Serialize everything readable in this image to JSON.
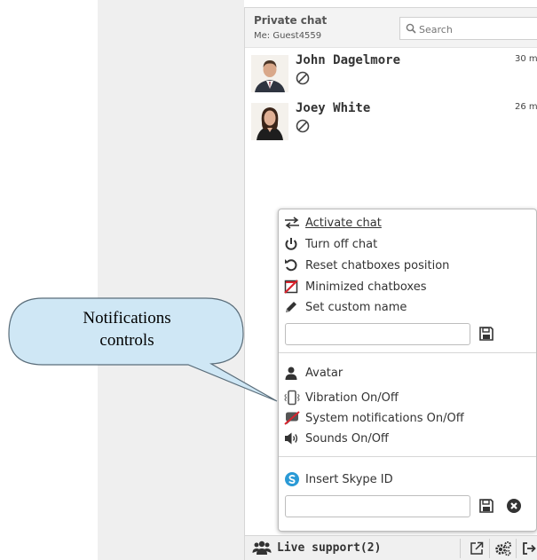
{
  "chat": {
    "title": "Private chat",
    "me": "Me: Guest4559",
    "search_placeholder": "Search",
    "contacts": [
      {
        "name": "John Dagelmore",
        "time": "30 m",
        "status_icon": "blocked-icon",
        "avatar": "man-in-suit"
      },
      {
        "name": "Joey White",
        "time": "26 m",
        "status_icon": "blocked-icon",
        "avatar": "woman-in-dark-top"
      }
    ]
  },
  "menu": {
    "activate": "Activate chat",
    "turn_off": "Turn off chat",
    "reset": "Reset chatboxes position",
    "minimized": "Minimized chatboxes",
    "custom_name": "Set custom name",
    "name_input_value": "",
    "avatar": "Avatar",
    "vibration": "Vibration On/Off",
    "system_notifications": "System notifications On/Off",
    "sounds": "Sounds On/Off",
    "skype": "Insert Skype ID",
    "skype_input_value": ""
  },
  "bottom_bar": {
    "live_support": "Live support(2)",
    "icons": [
      "users-icon",
      "popout-icon",
      "gears-icon",
      "logout-icon"
    ]
  },
  "callout": {
    "line1": "Notifications",
    "line2": "controls"
  },
  "colors": {
    "accent_red": "#d9232d",
    "skype_blue": "#2a9ad6",
    "callout_fill": "#cfe7f5",
    "panel_header": "#f3f3f3"
  }
}
